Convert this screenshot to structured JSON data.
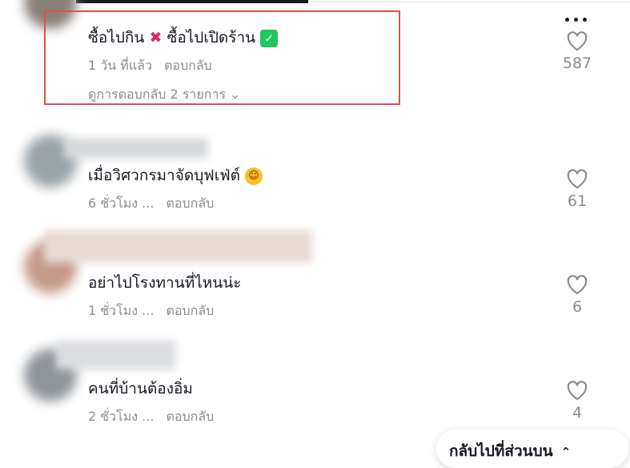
{
  "comments": [
    {
      "text": "ซื้อไปกิน",
      "text_after": "ซื้อไปเปิดร้าน",
      "time": "1 วัน ที่แล้ว",
      "reply": "ตอบกลับ",
      "likes": "587",
      "view_replies": "ดูการตอบกลับ 2 รายการ"
    },
    {
      "text": "เมื่อวิศวกรมาจัดบุฟเฟ่ต์",
      "time": "6 ชั่วโมง ...",
      "reply": "ตอบกลับ",
      "likes": "61"
    },
    {
      "text": "อย่าไปโรงทานที่ไหนน่ะ",
      "time": "1 ชั่วโมง ...",
      "reply": "ตอบกลับ",
      "likes": "6"
    },
    {
      "text": "คนที่บ้านต้องอิ่ม",
      "time": "2 ชั่วโมง ...",
      "reply": "ตอบกลับ",
      "likes": "4"
    }
  ],
  "back_to_top": "กลับไปที่ส่วนบน",
  "icons": {
    "more": "more-horizontal-icon",
    "like": "heart-outline-icon",
    "cross": "cross-mark-emoji",
    "check": "check-mark-emoji",
    "laugh": "laughing-emoji",
    "chevron": "chevron-up-icon"
  },
  "colors": {
    "highlight": "#d9534f",
    "muted": "#8a8b91",
    "text": "#161823"
  }
}
